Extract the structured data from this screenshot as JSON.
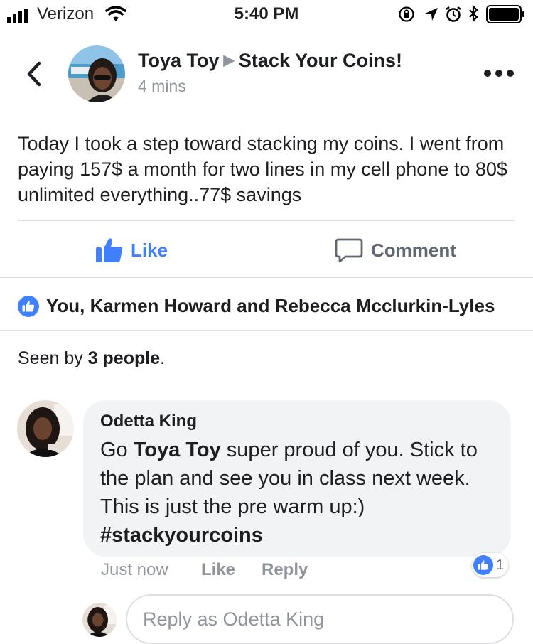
{
  "status_bar": {
    "carrier": "Verizon",
    "time": "5:40 PM"
  },
  "post": {
    "author": "Toya Toy",
    "group": "Stack Your Coins!",
    "time": "4 mins",
    "text": "Today I took a step toward stacking my coins. I went from paying 157$ a month for two lines in my cell phone to 80$ unlimited everything..77$ savings"
  },
  "actions": {
    "like_label": "Like",
    "comment_label": "Comment"
  },
  "reactions": {
    "names": "You, Karmen Howard and Rebecca Mcclurkin-Lyles"
  },
  "seen": {
    "prefix": "Seen by ",
    "count": "3 people",
    "suffix": "."
  },
  "comment": {
    "author": "Odetta King",
    "text_prefix": "Go ",
    "text_mention": "Toya Toy",
    "text_rest": " super proud of you. Stick to the plan and see you in class next week. This is just the pre warm up:)",
    "hashtag": "#stackyourcoins",
    "time": "Just now",
    "like_label": "Like",
    "reply_label": "Reply",
    "like_count": "1"
  },
  "reply_box": {
    "placeholder": "Reply as Odetta King"
  },
  "colors": {
    "accent": "#4080ff",
    "muted": "#90949c",
    "bubble": "#f2f3f5"
  }
}
